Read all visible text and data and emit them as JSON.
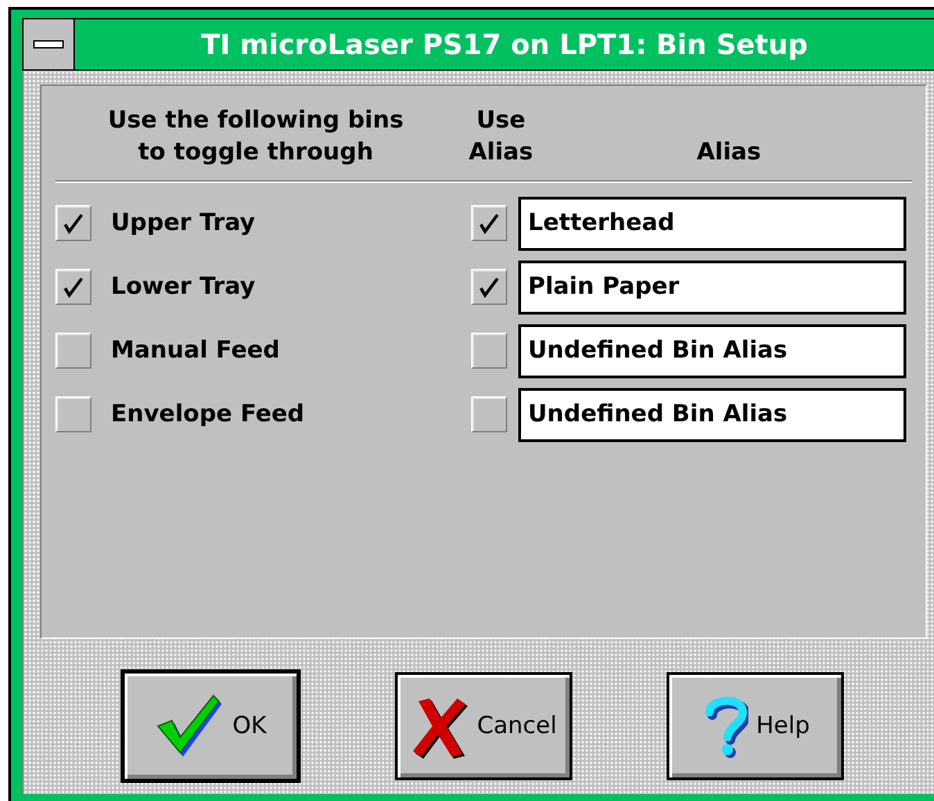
{
  "window": {
    "title": "TI microLaser PS17 on LPT1: Bin Setup"
  },
  "headings": {
    "bins": "Use the following bins\nto toggle through",
    "use_alias": "Use\nAlias",
    "alias": "Alias"
  },
  "bins": [
    {
      "name": "Upper Tray",
      "checked": true,
      "use_alias": true,
      "alias": "Letterhead"
    },
    {
      "name": "Lower Tray",
      "checked": true,
      "use_alias": true,
      "alias": "Plain Paper"
    },
    {
      "name": "Manual Feed",
      "checked": false,
      "use_alias": false,
      "alias": "Undefined Bin Alias"
    },
    {
      "name": "Envelope Feed",
      "checked": false,
      "use_alias": false,
      "alias": "Undefined Bin Alias"
    }
  ],
  "buttons": [
    {
      "kind": "ok",
      "label": "OK",
      "default": true
    },
    {
      "kind": "cancel",
      "label": "Cancel",
      "default": false
    },
    {
      "kind": "help",
      "label": "Help",
      "default": false
    }
  ]
}
